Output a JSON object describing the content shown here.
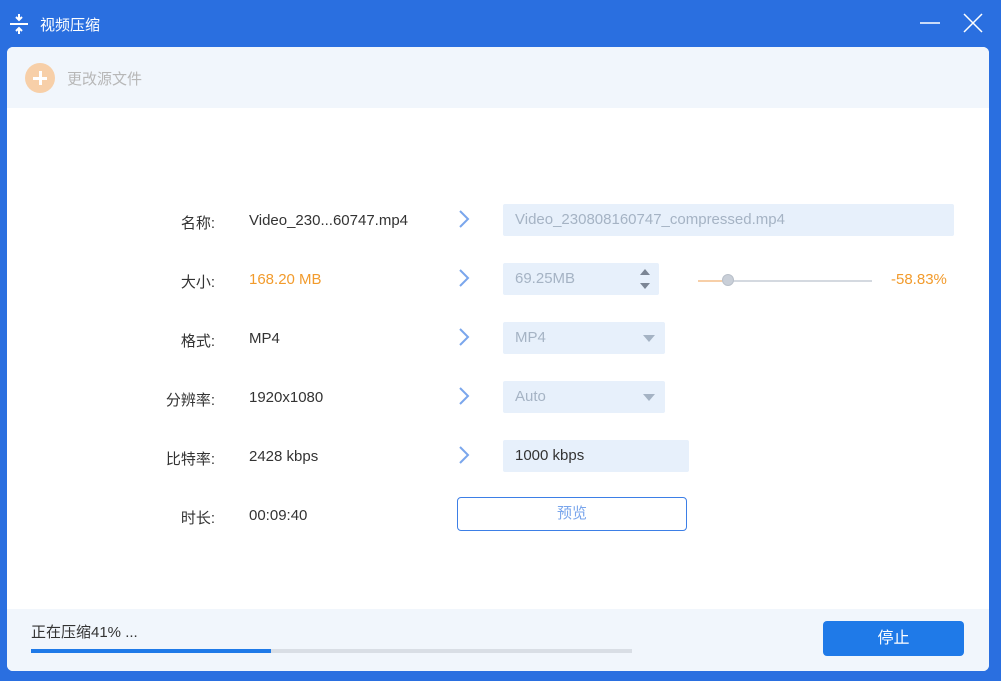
{
  "window": {
    "title": "视频压缩",
    "icon": "compress-icon"
  },
  "toolbar": {
    "change_source_label": "更改源文件"
  },
  "rows": {
    "name": {
      "label": "名称:",
      "source": "Video_230...60747.mp4",
      "target": "Video_230808160747_compressed.mp4"
    },
    "size": {
      "label": "大小:",
      "source": "168.20 MB",
      "target": "69.25MB",
      "slider_fraction": 0.17,
      "percent": "-58.83%"
    },
    "format": {
      "label": "格式:",
      "source": "MP4",
      "target": "MP4"
    },
    "resolution": {
      "label": "分辨率:",
      "source": "1920x1080",
      "target": "Auto"
    },
    "bitrate": {
      "label": "比特率:",
      "source": "2428 kbps",
      "target": "1000 kbps"
    },
    "duration": {
      "label": "时长:",
      "source": "00:09:40",
      "preview_label": "预览"
    }
  },
  "footer": {
    "status": "正在压缩41% ...",
    "progress": 0.4,
    "stop_label": "停止"
  },
  "colors": {
    "accent": "#1f7ae8",
    "title_bar": "#2a6fe0",
    "orange": "#f29b2c"
  }
}
